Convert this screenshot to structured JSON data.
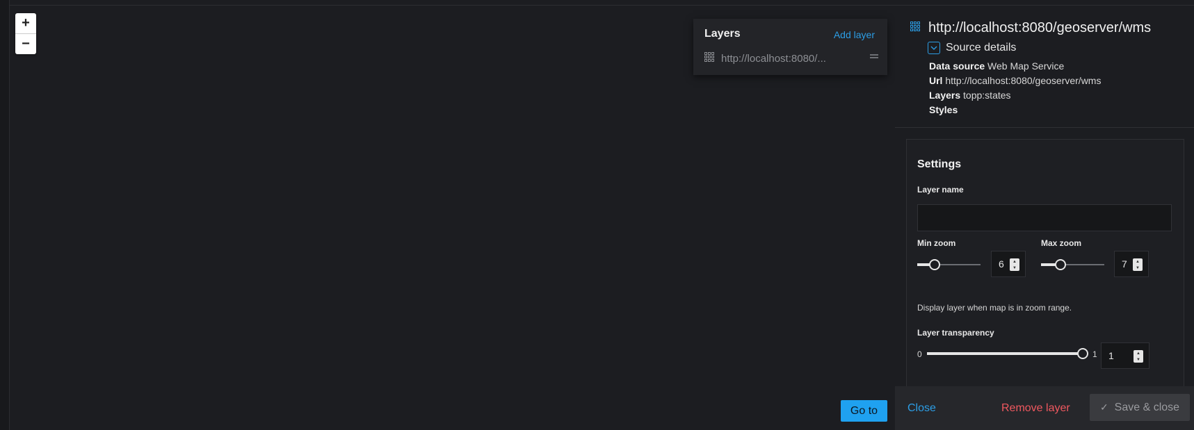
{
  "map": {
    "zoom_in_label": "+",
    "zoom_out_label": "−",
    "goto_label": "Go to"
  },
  "layers_panel": {
    "title": "Layers",
    "add_layer_label": "Add layer",
    "items": [
      {
        "name": "http://localhost:8080/...",
        "icon": "grid-icon"
      }
    ]
  },
  "source": {
    "title": "http://localhost:8080/geoserver/wms",
    "icon": "grid-icon",
    "details_label": "Source details",
    "details": {
      "data_source_label": "Data source",
      "data_source_value": "Web Map Service",
      "url_label": "Url",
      "url_value": "http://localhost:8080/geoserver/wms",
      "layers_label": "Layers",
      "layers_value": "topp:states",
      "styles_label": "Styles",
      "styles_value": ""
    }
  },
  "settings": {
    "title": "Settings",
    "layer_name_label": "Layer name",
    "layer_name_value": "",
    "min_zoom_label": "Min zoom",
    "min_zoom_value": "6",
    "max_zoom_label": "Max zoom",
    "max_zoom_value": "7",
    "zoom_hint": "Display layer when map is in zoom range.",
    "transparency_label": "Layer transparency",
    "transparency_min": "0",
    "transparency_max": "1",
    "transparency_value": "1",
    "slider_levels": {
      "min_zoom": 0.23,
      "max_zoom": 0.27,
      "transparency": 1.0
    }
  },
  "footer": {
    "close_label": "Close",
    "remove_label": "Remove layer",
    "save_label": "Save & close"
  },
  "colors": {
    "accent": "#1fa1f0",
    "danger": "#f0585f",
    "background": "#1c1d21"
  }
}
